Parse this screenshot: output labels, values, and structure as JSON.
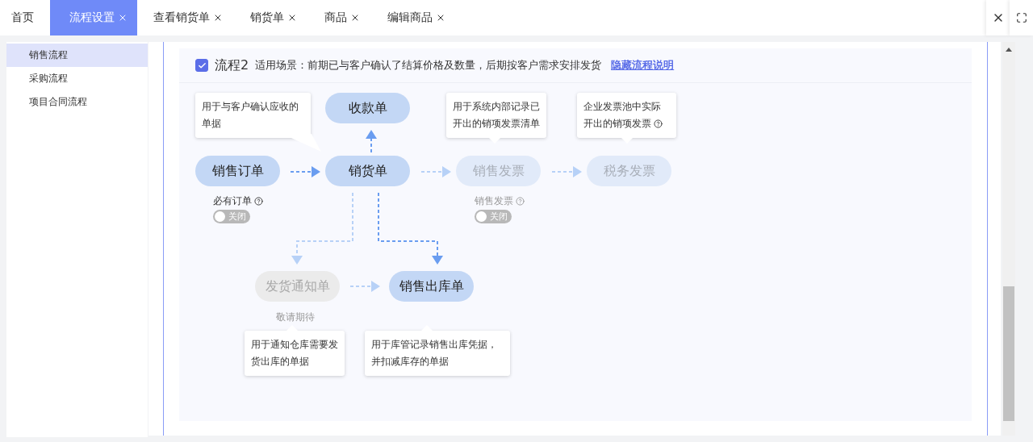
{
  "tabs": [
    {
      "label": "首页",
      "selected": false,
      "closable": false
    },
    {
      "label": "流程设置",
      "selected": true,
      "closable": true
    },
    {
      "label": "查看销货单",
      "selected": false,
      "closable": true
    },
    {
      "label": "销货单",
      "selected": false,
      "closable": true
    },
    {
      "label": "商品",
      "selected": false,
      "closable": true
    },
    {
      "label": "编辑商品",
      "selected": false,
      "closable": true
    }
  ],
  "sidebar": {
    "items": [
      {
        "label": "销售流程",
        "selected": true
      },
      {
        "label": "采购流程",
        "selected": false
      },
      {
        "label": "项目合同流程",
        "selected": false
      }
    ]
  },
  "panel": {
    "checked": true,
    "title": "流程2",
    "scene": "适用场景：前期已与客户确认了结算价格及数量，后期按客户需求安排发货",
    "link": "隐藏流程说明"
  },
  "diagram": {
    "nodes": [
      {
        "label": "销售订单",
        "kind": "active"
      },
      {
        "label": "销货单",
        "kind": "active"
      },
      {
        "label": "收款单",
        "kind": "active"
      },
      {
        "label": "销售发票",
        "kind": "faded"
      },
      {
        "label": "税务发票",
        "kind": "faded"
      },
      {
        "label": "发货通知单",
        "kind": "soon"
      },
      {
        "label": "销售出库单",
        "kind": "active"
      }
    ],
    "notes": [
      {
        "text": "用于与客户确认应收的单据",
        "help_icon": false
      },
      {
        "text": "用于系统内部记录已开出的销项发票清单",
        "help_icon": false
      },
      {
        "text": "企业发票池中实际开出的销项发票",
        "help_icon": true
      },
      {
        "text": "用于通知仓库需要发货出库的单据",
        "help_icon": false
      },
      {
        "text": "用于库管记录销售出库凭据，并扣减库存的单据",
        "help_icon": false
      }
    ],
    "switches": [
      {
        "label": "必有订单",
        "on": false,
        "state_text": "关闭",
        "faded": false
      },
      {
        "label": "销售发票",
        "on": false,
        "state_text": "关闭",
        "faded": true
      }
    ],
    "soon_label": "敬请期待"
  }
}
